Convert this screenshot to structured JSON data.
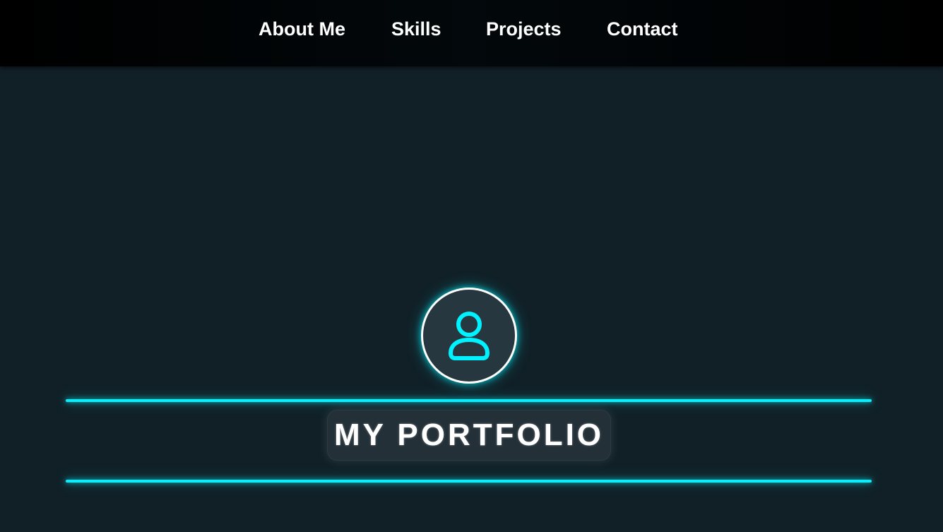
{
  "nav": {
    "items": [
      {
        "label": "About Me"
      },
      {
        "label": "Skills"
      },
      {
        "label": "Projects"
      },
      {
        "label": "Contact"
      }
    ]
  },
  "hero": {
    "avatar_icon": "user-icon",
    "title": "MY PORTFOLIO"
  },
  "colors": {
    "background": "#112027",
    "nav_background": "#000000",
    "accent": "#00f2ff",
    "text": "#ffffff",
    "panel": "#233038"
  }
}
